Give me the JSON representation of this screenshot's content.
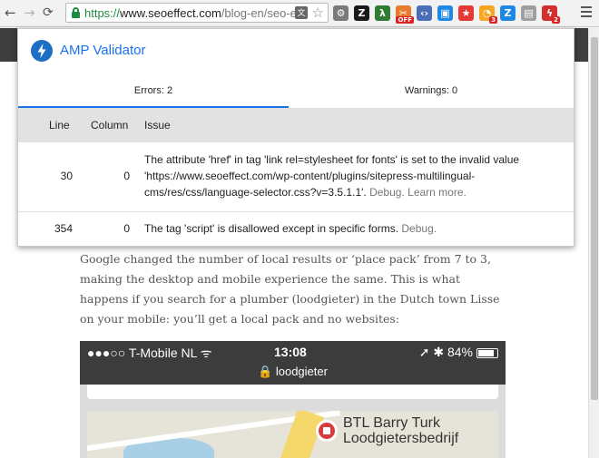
{
  "browser": {
    "url": {
      "scheme": "https://",
      "host": "www.seoeffect.com",
      "path": "/blog-en/seo-e"
    },
    "icons": [
      "back-arrow-icon",
      "forward-arrow-icon",
      "reload-icon",
      "lock-icon",
      "translate-icon",
      "star-icon",
      "menu-icon"
    ],
    "extensions": [
      {
        "name": "gear-extension-icon",
        "glyph": "⚙",
        "color": "#7a7a7a",
        "badge": ""
      },
      {
        "name": "z-extension-icon",
        "glyph": "Z",
        "color": "#1a1a1a",
        "badge": ""
      },
      {
        "name": "lambda-extension-icon",
        "glyph": "λ",
        "color": "#2e7d32",
        "badge": ""
      },
      {
        "name": "off-extension-icon",
        "glyph": "✂",
        "color": "#e8792d",
        "badge": "OFF"
      },
      {
        "name": "code-extension-icon",
        "glyph": "‹›",
        "color": "#4a6fb8",
        "badge": ""
      },
      {
        "name": "window-extension-icon",
        "glyph": "▣",
        "color": "#1e88e5",
        "badge": ""
      },
      {
        "name": "star-extension-icon",
        "glyph": "★",
        "color": "#e53935",
        "badge": ""
      },
      {
        "name": "pie-extension-icon",
        "glyph": "◔",
        "color": "#f5a623",
        "badge": "3"
      },
      {
        "name": "z-blue-extension-icon",
        "glyph": "Z",
        "color": "#1e88e5",
        "badge": ""
      },
      {
        "name": "page-extension-icon",
        "glyph": "▤",
        "color": "#9e9e9e",
        "badge": ""
      },
      {
        "name": "amp-extension-icon",
        "glyph": "ϟ",
        "color": "#d32f2f",
        "badge": "2"
      }
    ]
  },
  "popup": {
    "title": "AMP Validator",
    "tabs": [
      {
        "label": "Errors: 2",
        "active": true
      },
      {
        "label": "Warnings: 0",
        "active": false
      }
    ],
    "columns": [
      "Line",
      "Column",
      "Issue"
    ],
    "rows": [
      {
        "line": "30",
        "column": "0",
        "issue": "The attribute 'href' in tag 'link rel=stylesheet for fonts' is set to the invalid value 'https://www.seoeffect.com/wp-content/plugins/sitepress-multilingual-cms/res/css/language-selector.css?v=3.5.1.1'.",
        "links": [
          "Debug.",
          "Learn more."
        ]
      },
      {
        "line": "354",
        "column": "0",
        "issue": "The tag 'script' is disallowed except in specific forms.",
        "links": [
          "Debug."
        ]
      }
    ]
  },
  "article": {
    "text": "Google changed the number of local results or ‘place pack’ from 7 to 3, making the desktop and mobile experience the same. This is what happens if you search for a plumber (loodgieter) in the Dutch town Lisse on your mobile: you’ll get a local pack and no websites:"
  },
  "phone": {
    "carrier": "●●●○○ T-Mobile NL",
    "wifi": "ᯤ",
    "time": "13:08",
    "status_right": "➚ ✱ 84%",
    "search_query": "🔒 loodgieter",
    "map_label": "BTL Barry Turk Loodgietersbedrijf"
  },
  "colors": {
    "accent": "#1a73e8",
    "table_header": "#e2e2e2",
    "page_header": "#3e3e3e"
  }
}
